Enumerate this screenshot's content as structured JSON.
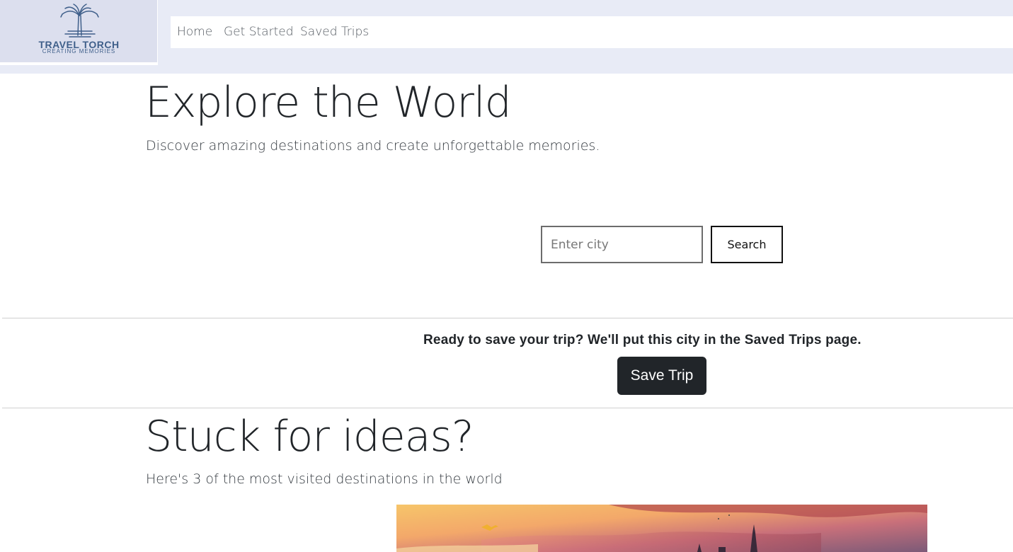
{
  "logo": {
    "title": "TRAVEL TORCH",
    "subtitle": "CREATING MEMORIES",
    "icon": "palm-tree-icon"
  },
  "nav": {
    "items": [
      {
        "label": "Home"
      },
      {
        "label": "Get Started"
      },
      {
        "label": "Saved Trips"
      }
    ]
  },
  "hero": {
    "title": "Explore the World",
    "subtitle": "Discover amazing destinations and create unforgettable memories."
  },
  "search": {
    "placeholder": "Enter city",
    "value": "",
    "button_label": "Search"
  },
  "save": {
    "prompt": "Ready to save your trip? We'll put this city in the Saved Trips page.",
    "button_label": "Save Trip"
  },
  "ideas": {
    "title": "Stuck for ideas?",
    "subtitle": "Here's 3 of the most visited destinations in the world"
  },
  "colors": {
    "header_bg": "#e8ebf6",
    "logo_text": "#3f5f8a",
    "dark_button": "#212529"
  }
}
